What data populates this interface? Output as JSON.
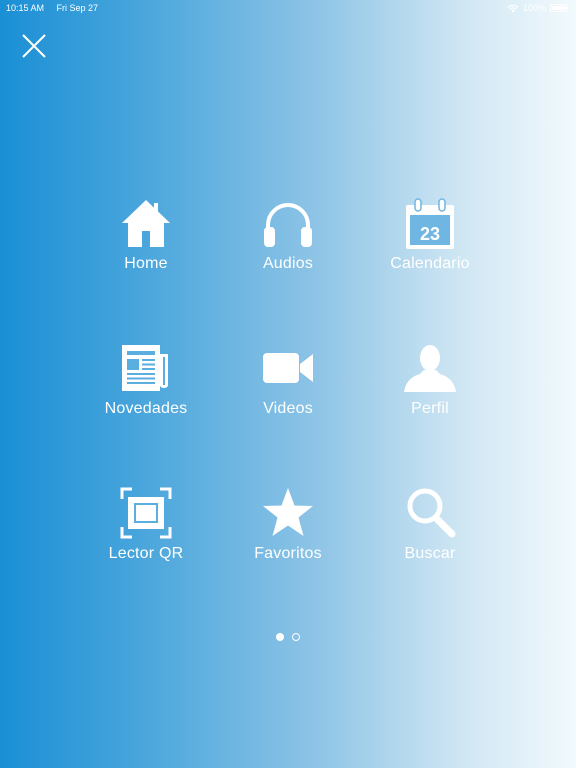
{
  "status_bar": {
    "time": "10:15 AM",
    "date": "Fri Sep 27",
    "battery": "100%"
  },
  "close": {
    "icon": "close-icon"
  },
  "menu": [
    {
      "label": "Home",
      "icon": "home-icon"
    },
    {
      "label": "Audios",
      "icon": "headphones-icon"
    },
    {
      "label": "Calendario",
      "icon": "calendar-icon",
      "icon_text": "23"
    },
    {
      "label": "Novedades",
      "icon": "newspaper-icon"
    },
    {
      "label": "Videos",
      "icon": "video-camera-icon"
    },
    {
      "label": "Perfil",
      "icon": "user-icon"
    },
    {
      "label": "Lector QR",
      "icon": "qr-scanner-icon"
    },
    {
      "label": "Favoritos",
      "icon": "star-icon"
    },
    {
      "label": "Buscar",
      "icon": "search-icon"
    }
  ],
  "pager": {
    "pages": 2,
    "current": 1
  },
  "colors": {
    "gradient_start": "#1a8fd5",
    "gradient_end": "#f2fafd",
    "foreground": "#ffffff"
  }
}
